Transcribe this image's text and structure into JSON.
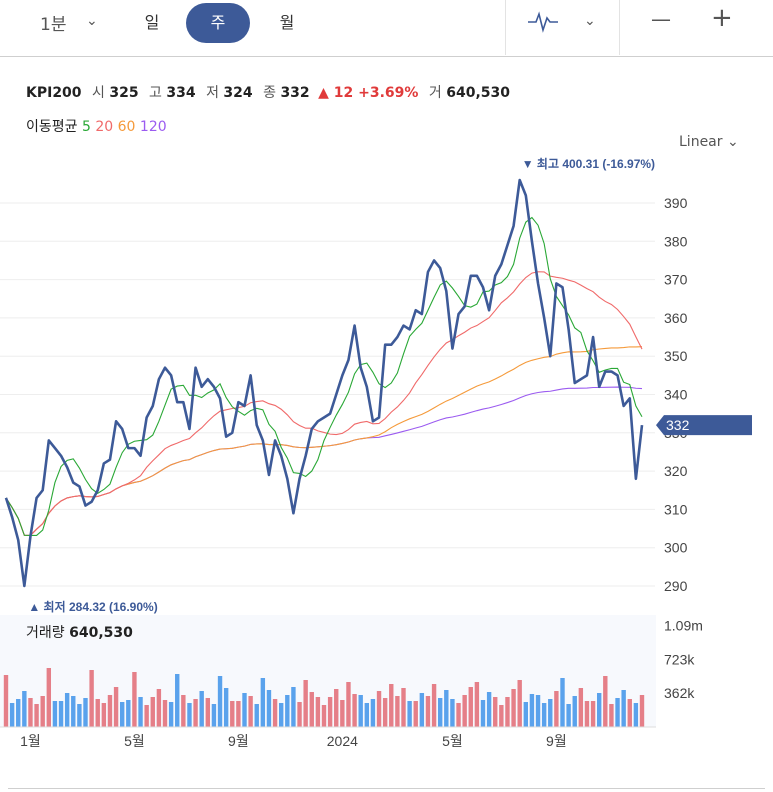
{
  "toolbar": {
    "interval": "1분",
    "periods": [
      "일",
      "주",
      "월"
    ],
    "active_period": "주",
    "zoom_out": "—",
    "zoom_in": "+"
  },
  "quote": {
    "symbol": "KPI200",
    "open_label": "시",
    "open": "325",
    "high_label": "고",
    "high": "334",
    "low_label": "저",
    "low": "324",
    "close_label": "종",
    "close": "332",
    "change": "▲ 12 +3.69%",
    "volume_label": "거",
    "volume": "640,530"
  },
  "ma_legend": {
    "title": "이동평균",
    "p5": "5",
    "p20": "20",
    "p60": "60",
    "p120": "120"
  },
  "scale_mode": "Linear",
  "colors": {
    "price": "#3d5a98",
    "ma5": "#2aa836",
    "ma20": "#f06a6a",
    "ma60": "#f59a3a",
    "ma120": "#9b5bf0",
    "up": "#e57f88",
    "down": "#5aa2ec",
    "accent": "#3d5a98"
  },
  "chart_data": {
    "type": "line",
    "y_ticks": [
      290,
      300,
      310,
      320,
      330,
      340,
      350,
      360,
      370,
      380,
      390
    ],
    "ylim": [
      284,
      402
    ],
    "x_tick_labels": [
      {
        "label": "1월",
        "i": 4
      },
      {
        "label": "5월",
        "i": 21
      },
      {
        "label": "9월",
        "i": 38
      },
      {
        "label": "2024",
        "i": 55
      },
      {
        "label": "5월",
        "i": 73
      },
      {
        "label": "9월",
        "i": 90
      }
    ],
    "price": [
      313,
      308,
      302,
      290,
      303,
      313,
      315,
      328,
      326,
      324,
      321,
      317,
      316,
      311,
      312,
      315,
      322,
      323,
      333,
      331,
      326,
      326,
      324,
      334,
      337,
      344,
      347,
      345,
      338,
      338,
      331,
      347,
      342,
      344,
      342,
      339,
      329,
      330,
      338,
      337,
      345,
      332,
      328,
      319,
      328,
      324,
      318,
      309,
      318,
      324,
      331,
      333,
      334,
      335,
      340,
      345,
      349,
      358,
      347,
      342,
      333,
      334,
      353,
      353,
      355,
      358,
      357,
      362,
      361,
      372,
      375,
      373,
      367,
      352,
      361,
      363,
      371,
      371,
      368,
      362,
      371,
      374,
      379,
      384,
      396,
      392,
      380,
      369,
      360,
      350,
      369,
      368,
      357,
      343,
      344,
      345,
      355,
      342,
      346,
      346,
      345,
      337,
      339,
      318,
      332
    ],
    "ma_periods": [
      5,
      20,
      60,
      120
    ],
    "current_price_tag": "332",
    "high_annotation": "▼ 최고 400.31 (-16.97%)",
    "high_index": 84,
    "low_annotation": "▲ 최저 284.32 (16.90%)",
    "low_index": 3,
    "volume": {
      "label": "거래량",
      "value": "640,530",
      "ticks": [
        {
          "label": "1.09m",
          "v": 1090000
        },
        {
          "label": "723k",
          "v": 723000
        },
        {
          "label": "362k",
          "v": 362000
        }
      ],
      "max": 1200000
    }
  }
}
